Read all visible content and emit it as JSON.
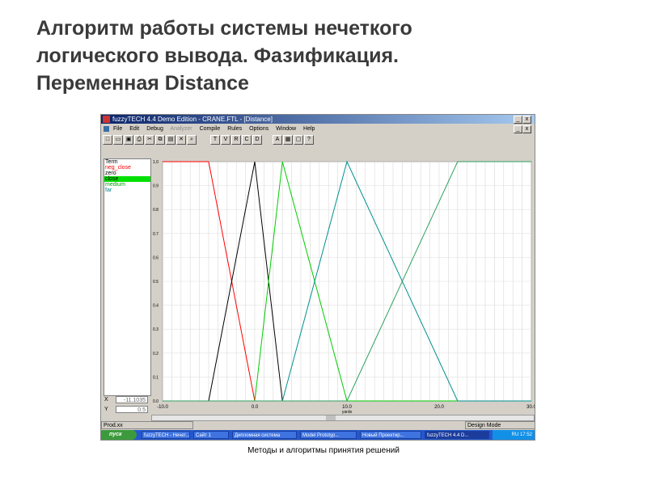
{
  "slide": {
    "title_lines": [
      "Алгоритм работы системы нечеткого",
      "логического вывода. Фазификация.",
      "Переменная Distance"
    ],
    "footer": "Методы и алгоритмы принятия решений"
  },
  "window": {
    "title": "fuzzyTECH 4.4 Demo Edition - CRANE.FTL - [Distance]",
    "buttons": [
      "_",
      "□",
      "x"
    ]
  },
  "menu": [
    "File",
    "Edit",
    "Debug",
    "Analyzer",
    "Compile",
    "Rules",
    "Options",
    "Window",
    "Help"
  ],
  "toolbar_icons": [
    "new-icon",
    "open-icon",
    "save-icon",
    "print-icon",
    "cut-icon",
    "copy-icon",
    "paste-icon",
    "delete-icon",
    "zoom-icon",
    "term-icon",
    "var-icon",
    "rule-icon",
    "compile-icon",
    "debug-icon",
    "analyze-icon",
    "chart-icon",
    "window-icon",
    "help-icon"
  ],
  "terms": {
    "header": "Term",
    "items": [
      {
        "label": "neg_close",
        "color": "#ff0000",
        "selected": false
      },
      {
        "label": "zero",
        "color": "#000000",
        "selected": false
      },
      {
        "label": "close",
        "color": "#000000",
        "selected": true
      },
      {
        "label": "medium",
        "color": "#00b000",
        "selected": false
      },
      {
        "label": "far",
        "color": "#009090",
        "selected": false
      }
    ]
  },
  "coords": {
    "x_label": "X",
    "x_value": "-11.1035",
    "y_label": "Y",
    "y_value": "0.5"
  },
  "statusbar": {
    "left": "Prod.xx",
    "right": "Design Mode"
  },
  "taskbar": {
    "start": "пуск",
    "tasks": [
      "fuzzyTECH - Нечет...",
      "Сайт 1",
      "Дипломная система",
      "Model Prototyp...",
      "Новый Проектир...",
      "fuzzyTECH 4.4 D..."
    ],
    "clock": "RU 17:52"
  },
  "chart_data": {
    "type": "line",
    "xlabel": "yards",
    "ylabel": "",
    "xlim": [
      -10,
      30
    ],
    "ylim": [
      0,
      1
    ],
    "x_ticks": [
      "-10.0",
      "0.0",
      "10.0",
      "20.0",
      "30.0"
    ],
    "y_ticks": [
      "1.0",
      "0.9",
      "0.8",
      "0.7",
      "0.6",
      "0.5",
      "0.4",
      "0.3",
      "0.2",
      "0.1",
      "0.0"
    ],
    "grid": true,
    "series": [
      {
        "name": "neg_close",
        "color": "#ff0000",
        "x": [
          -10,
          -5,
          0,
          30
        ],
        "y": [
          1,
          1,
          0,
          0
        ]
      },
      {
        "name": "zero",
        "color": "#000000",
        "x": [
          -5,
          0,
          3,
          30
        ],
        "y": [
          0,
          1,
          0,
          0
        ]
      },
      {
        "name": "close",
        "color": "#00cc00",
        "x": [
          -10,
          0,
          3,
          10,
          30
        ],
        "y": [
          0,
          0,
          1,
          0,
          0
        ]
      },
      {
        "name": "medium",
        "color": "#009090",
        "x": [
          -10,
          3,
          10,
          22,
          30
        ],
        "y": [
          0,
          0,
          1,
          0,
          0
        ]
      },
      {
        "name": "far",
        "color": "#30a060",
        "x": [
          -10,
          10,
          22,
          30
        ],
        "y": [
          0,
          0,
          1,
          1
        ]
      }
    ]
  }
}
